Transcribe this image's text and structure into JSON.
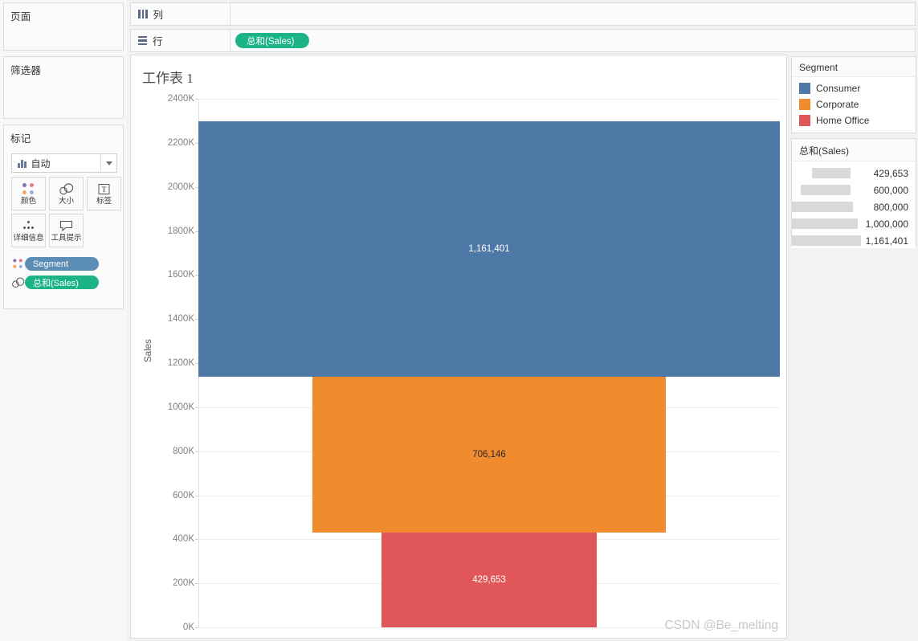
{
  "left_panel": {
    "pages_title": "页面",
    "filters_title": "筛选器",
    "marks_title": "标记",
    "mark_type": {
      "label": "自动",
      "icon": "bar-chart-icon",
      "arrow_icon": "chevron-down-icon"
    },
    "mark_buttons": [
      {
        "label": "颜色",
        "icon": "color-dots-icon"
      },
      {
        "label": "大小",
        "icon": "size-circles-icon"
      },
      {
        "label": "标签",
        "icon": "label-text-icon"
      },
      {
        "label": "详细信息",
        "icon": "detail-dots-icon"
      },
      {
        "label": "工具提示",
        "icon": "tooltip-bubble-icon"
      }
    ],
    "pills": [
      {
        "label": "Segment",
        "color": "#5c8db5",
        "icon": "color-dots-icon"
      },
      {
        "label": "总和(Sales)",
        "color": "#1cb487",
        "icon": "size-circles-icon"
      }
    ]
  },
  "shelves": {
    "columns": {
      "label": "列",
      "icon": "columns-icon",
      "fields": []
    },
    "rows": {
      "label": "行",
      "icon": "rows-icon",
      "fields": [
        {
          "label": "总和(Sales)",
          "color": "#1cb487"
        }
      ]
    }
  },
  "view": {
    "worksheet_title": "工作表 1",
    "watermark": "CSDN @Be_melting"
  },
  "legends": {
    "color": {
      "title": "Segment",
      "items": [
        {
          "label": "Consumer",
          "color": "#4e79a7"
        },
        {
          "label": "Corporate",
          "color": "#f08c2e"
        },
        {
          "label": "Home Office",
          "color": "#e15759"
        }
      ]
    },
    "size": {
      "title": "总和(Sales)",
      "swatch_color": "#d9d9d9",
      "items": [
        {
          "value": "429,653",
          "width": 48
        },
        {
          "value": "600,000",
          "width": 62
        },
        {
          "value": "800,000",
          "width": 79
        },
        {
          "value": "1,000,000",
          "width": 96
        },
        {
          "value": "1,161,401",
          "width": 110
        }
      ]
    }
  },
  "chart_data": {
    "type": "bar",
    "orientation": "horizontal-centered-stack",
    "title": "工作表 1",
    "xlabel": "",
    "ylabel": "Sales",
    "ylim": [
      0,
      2400000
    ],
    "ytick_step": 200000,
    "ytick_labels": [
      "0K",
      "200K",
      "400K",
      "600K",
      "800K",
      "1000K",
      "1200K",
      "1400K",
      "1600K",
      "1800K",
      "2000K",
      "2200K",
      "2400K"
    ],
    "ytick_values": [
      0,
      200000,
      400000,
      600000,
      800000,
      1000000,
      1200000,
      1400000,
      1600000,
      1800000,
      2000000,
      2200000,
      2400000
    ],
    "grid": true,
    "legend_position": "right",
    "categories": [
      "Consumer",
      "Corporate",
      "Home Office"
    ],
    "values": [
      1161401,
      706146,
      429653
    ],
    "labels": [
      "1,161,401",
      "706,146",
      "429,653"
    ],
    "colors": [
      "#4e79a7",
      "#f08c2e",
      "#e15759"
    ],
    "label_colors": [
      "#ffffff",
      "#2a2a2a",
      "#ffffff"
    ],
    "bars": [
      {
        "name": "Consumer",
        "value": 1161401,
        "label": "1,161,401",
        "color": "#4e79a7",
        "label_color": "#ffffff",
        "y_bottom": 1136241,
        "y_top": 2297642,
        "width_frac": 1.0
      },
      {
        "name": "Corporate",
        "value": 706146,
        "label": "706,146",
        "color": "#f08c2e",
        "label_color": "#2a2a2a",
        "y_bottom": 430095,
        "y_top": 1136241,
        "width_frac": 0.608
      },
      {
        "name": "Home Office",
        "value": 429653,
        "label": "429,653",
        "color": "#e15759",
        "label_color": "#ffffff",
        "y_bottom": 0,
        "y_top": 429653,
        "width_frac": 0.37
      }
    ]
  }
}
